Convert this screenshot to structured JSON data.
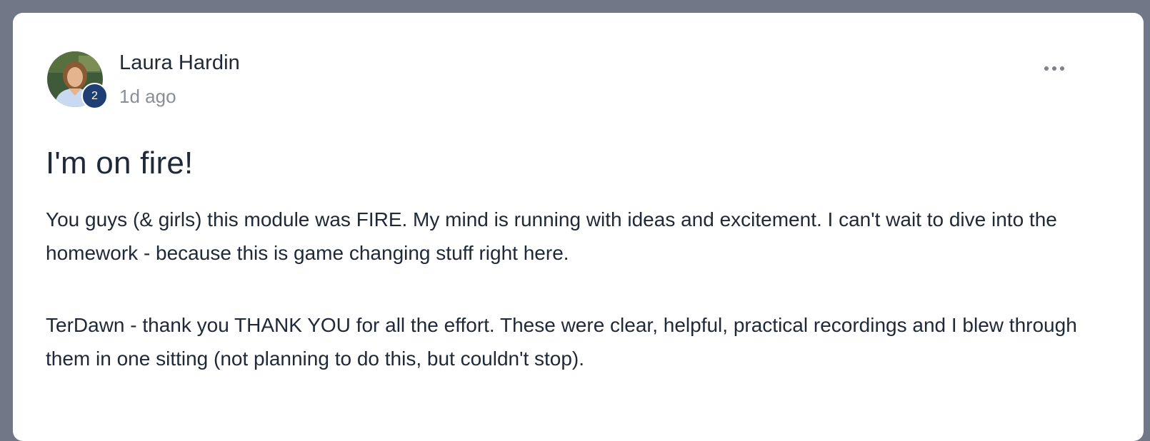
{
  "post": {
    "author": {
      "name": "Laura Hardin",
      "level": "2"
    },
    "timestamp": "1d ago",
    "more_icon": "ellipsis-horizontal-icon",
    "title": "I'm on fire!",
    "paragraphs": [
      "You guys (& girls) this module was FIRE. My mind is running with ideas and excitement. I can't wait to dive into the homework - because this is game changing stuff right here.",
      "TerDawn - thank you THANK YOU for all the effort. These were clear, helpful, practical recordings and I blew through them in one sitting (not planning to do this, but couldn't stop)."
    ]
  },
  "colors": {
    "page_background": "#707888",
    "card_background": "#ffffff",
    "text_primary": "#202938",
    "text_muted": "#8a8e96",
    "badge_background": "#1f3f74"
  }
}
